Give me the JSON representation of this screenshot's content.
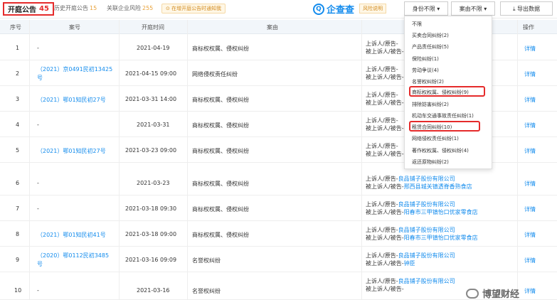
{
  "tabs": {
    "active": {
      "label": "开庭公告",
      "count": "45"
    },
    "history": {
      "label": "历史开庭公告",
      "count": "15"
    },
    "related": {
      "label": "关联企业风险",
      "count": "255"
    },
    "notice": "⊙ 在增开庭公告时通知我"
  },
  "brand": {
    "logo": "企查查",
    "logo_glyph": "Q",
    "risk_label": "风险说明"
  },
  "toolbar": {
    "identity_filter": "身份不限 ▾",
    "cause_filter": "案由不限 ▾",
    "export": "⤓ 导出数据"
  },
  "columns": [
    "序号",
    "案号",
    "开庭时间",
    "案由",
    "",
    "操作"
  ],
  "rows": [
    {
      "no": "1",
      "case_no": "-",
      "date": "2021-04-19",
      "cause": "商标权权属、侵权纠纷",
      "p1": "上诉人/原告-",
      "p1_name": "",
      "p2": "被上诉人/被告-",
      "p2_name": "",
      "action": "详情"
    },
    {
      "no": "2",
      "case_no": "（2021）京0491民初13425号",
      "date": "2021-04-15 09:00",
      "cause": "网络侵权责任纠纷",
      "p1": "上诉人/原告-",
      "p1_name": "",
      "p2": "被上诉人/被告-",
      "p2_name": "",
      "action": "详情"
    },
    {
      "no": "3",
      "case_no": "（2021）鄂01知民初27号",
      "date": "2021-03-31 14:00",
      "cause": "商标权权属、侵权纠纷",
      "p1": "上诉人/原告-",
      "p1_name": "",
      "p2": "被上诉人/被告-",
      "p2_name": "",
      "action": "详情"
    },
    {
      "no": "4",
      "case_no": "-",
      "date": "2021-03-31",
      "cause": "商标权权属、侵权纠纷",
      "p1": "上诉人/原告-",
      "p1_name": "",
      "p2": "被上诉人/被告-",
      "p2_name": "",
      "action": "详情"
    },
    {
      "no": "5",
      "case_no": "（2021）鄂01知民初27号",
      "date": "2021-03-23 09:00",
      "cause": "商标权权属、侵权纠纷",
      "p1": "上诉人/原告-",
      "p1_name": "",
      "p2": "被上诉人/被告-",
      "p2_name": "",
      "action": "详情"
    },
    {
      "no": "6",
      "case_no": "-",
      "date": "2021-03-23",
      "cause": "商标权权属、侵权纠纷",
      "p1": "上诉人/原告-",
      "p1_name": "良品铺子股份有限公司",
      "p2": "被上诉人/被告-",
      "p2_name": "邢西县城关镇透脊香熟食店",
      "action": "详情"
    },
    {
      "no": "7",
      "case_no": "-",
      "date": "2021-03-18 09:30",
      "cause": "商标权权属、侵权纠纷",
      "p1": "上诉人/原告-",
      "p1_name": "良品铺子股份有限公司",
      "p2": "被上诉人/被告-",
      "p2_name": "阳春市三甲镇怡口优家零食店",
      "action": "详情"
    },
    {
      "no": "8",
      "case_no": "（2021）鄂01知民初41号",
      "date": "2021-03-18 09:00",
      "cause": "商标权权属、侵权纠纷",
      "p1": "上诉人/原告-",
      "p1_name": "良品铺子股份有限公司",
      "p2": "被上诉人/被告-",
      "p2_name": "阳春市三甲镇怡口优家零食店",
      "action": "详情"
    },
    {
      "no": "9",
      "case_no": "（2020）鄂0112民初3485号",
      "date": "2021-03-16 09:09",
      "cause": "名誉权纠纷",
      "p1": "上诉人/原告-",
      "p1_name": "良品铺子股份有限公司",
      "p2": "被上诉人/被告-",
      "p2_name": "钟臣",
      "action": "详情"
    },
    {
      "no": "10",
      "case_no": "-",
      "date": "2021-03-16",
      "cause": "名誉权纠纷",
      "p1": "上诉人/原告-",
      "p1_name": "良品铺子股份有限公司",
      "p2": "被上诉人/被告-",
      "p2_name": "",
      "action": "详情"
    }
  ],
  "dropdown": {
    "items": [
      "不限",
      "买卖合同纠纷(2)",
      "产品责任纠纷(5)",
      "保险纠纷(1)",
      "劳动争议(4)",
      "名誉权纠纷(2)",
      "商标权权属、侵权纠纷(9)",
      "排除妨害纠纷(2)",
      "机动车交通事故责任纠纷(1)",
      "租赁合同纠纷(10)",
      "网络侵权责任纠纷(1)",
      "著作权权属、侵权纠纷(4)",
      "返还原物纠纷(2)"
    ]
  },
  "watermark": "博望财经",
  "colors": {
    "accent": "#128bed",
    "highlight": "#e52b2b",
    "warn": "#e8a23a"
  }
}
